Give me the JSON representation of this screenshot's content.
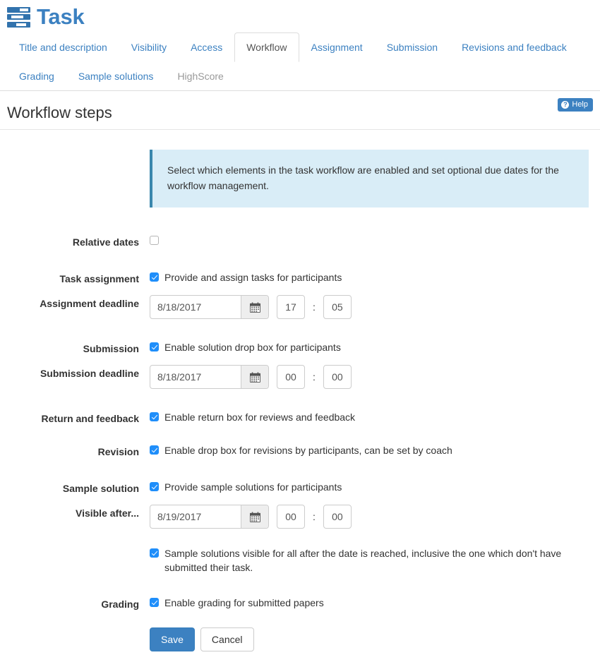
{
  "header": {
    "title": "Task",
    "icon": "task-list-icon"
  },
  "tabs": [
    {
      "label": "Title and description",
      "state": "default"
    },
    {
      "label": "Visibility",
      "state": "default"
    },
    {
      "label": "Access",
      "state": "default"
    },
    {
      "label": "Workflow",
      "state": "active"
    },
    {
      "label": "Assignment",
      "state": "default"
    },
    {
      "label": "Submission",
      "state": "default"
    },
    {
      "label": "Revisions and feedback",
      "state": "default"
    },
    {
      "label": "Grading",
      "state": "default"
    },
    {
      "label": "Sample solutions",
      "state": "default"
    },
    {
      "label": "HighScore",
      "state": "disabled"
    }
  ],
  "section": {
    "heading": "Workflow steps",
    "help_label": "Help",
    "help_icon": "question-circle-icon"
  },
  "info": {
    "text": "Select which elements in the task workflow are enabled and set optional due dates for the workflow management."
  },
  "form": {
    "relative_dates": {
      "label": "Relative dates",
      "checked": false
    },
    "task_assignment": {
      "label": "Task assignment",
      "checkbox_label": "Provide and assign tasks for participants",
      "checked": true
    },
    "assignment_deadline": {
      "label": "Assignment deadline",
      "date": "8/18/2017",
      "hour": "17",
      "minute": "05",
      "separator": ":",
      "calendar_icon": "calendar-icon"
    },
    "submission": {
      "label": "Submission",
      "checkbox_label": "Enable solution drop box for participants",
      "checked": true
    },
    "submission_deadline": {
      "label": "Submission deadline",
      "date": "8/18/2017",
      "hour": "00",
      "minute": "00",
      "separator": ":",
      "calendar_icon": "calendar-icon"
    },
    "return_feedback": {
      "label": "Return and feedback",
      "checkbox_label": "Enable return box for reviews and feedback",
      "checked": true
    },
    "revision": {
      "label": "Revision",
      "checkbox_label": "Enable drop box for revisions by participants, can be set by coach",
      "checked": true
    },
    "sample_solution": {
      "label": "Sample solution",
      "checkbox_label": "Provide sample solutions for participants",
      "checked": true
    },
    "visible_after": {
      "label": "Visible after...",
      "date": "8/19/2017",
      "hour": "00",
      "minute": "00",
      "separator": ":",
      "calendar_icon": "calendar-icon"
    },
    "sample_visible_all": {
      "checkbox_label": "Sample solutions visible for all after the date is reached, inclusive the one which don't have submitted their task.",
      "checked": true
    },
    "grading": {
      "label": "Grading",
      "checkbox_label": "Enable grading for submitted papers",
      "checked": true
    },
    "actions": {
      "save_label": "Save",
      "cancel_label": "Cancel"
    }
  },
  "colors": {
    "brand_blue": "#3c81c1",
    "link_blue": "#3c81c1",
    "checkbox_blue": "#1f8efa",
    "info_bg": "#d9edf7",
    "info_border": "#3a87ad"
  }
}
